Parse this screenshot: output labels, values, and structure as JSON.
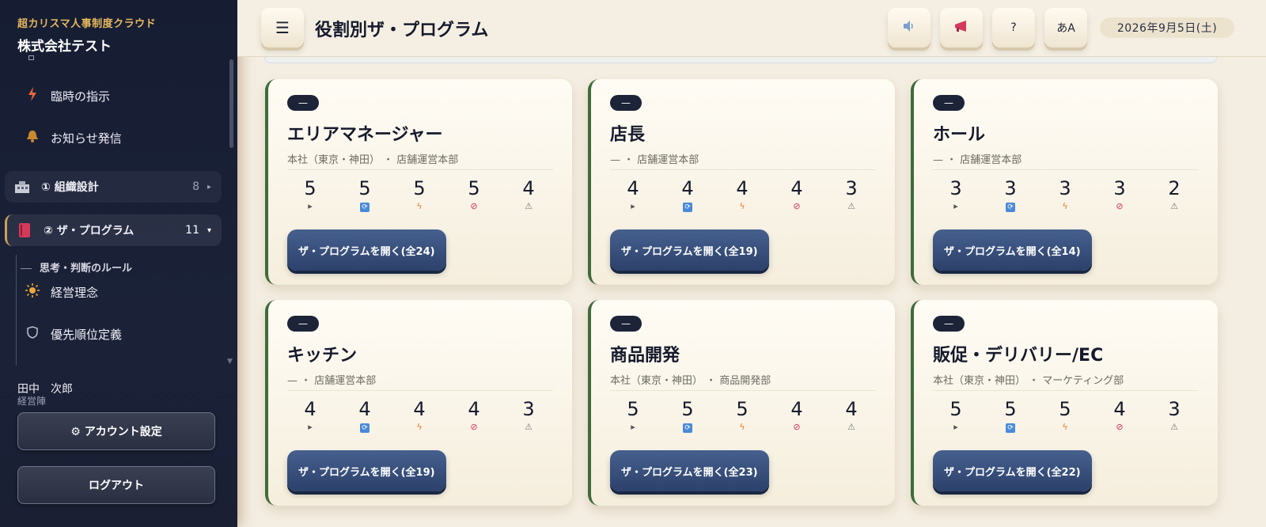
{
  "sidebar": {
    "kicker": "超カリスマ人事制度クラウド",
    "company": "株式会社テスト",
    "items": [
      {
        "icon": "bolt-icon",
        "label": "臨時の指示"
      },
      {
        "icon": "bell-icon",
        "label": "お知らせ発信"
      }
    ],
    "groups": [
      {
        "label": "① 組織設計",
        "count": "8",
        "arrow": "▸"
      },
      {
        "label": "② ザ・プログラム",
        "count": "11",
        "arrow": "▾"
      }
    ],
    "subhead": "思考・判断のルール",
    "subitems": [
      {
        "icon": "sun-icon",
        "label": "経営理念"
      },
      {
        "icon": "shield-icon",
        "label": "優先順位定義"
      }
    ],
    "user": {
      "name": "田中　次郎",
      "role": "経営陣"
    },
    "account_label": "⚙ アカウント設定",
    "logout_label": "ログアウト"
  },
  "header": {
    "menu_glyph": "☰",
    "title": "役割別ザ・プログラム",
    "buttons": [
      {
        "icon": "speaker-icon",
        "glyph": "🔈"
      },
      {
        "icon": "megaphone-icon",
        "glyph": "📢"
      },
      {
        "icon": "help-icon",
        "glyph": "?"
      },
      {
        "icon": "font-size-icon",
        "glyph": "あA"
      }
    ],
    "date": "2026年9月5日(土)"
  },
  "cards": [
    {
      "badge": "—",
      "name": "エリアマネージャー",
      "meta": "本社（東京・神田） ・ 店舗運営本部",
      "stats": [
        "5",
        "5",
        "5",
        "5",
        "4"
      ],
      "button": "ザ・プログラムを開く(全24)"
    },
    {
      "badge": "—",
      "name": "店長",
      "meta": "— ・ 店舗運営本部",
      "stats": [
        "4",
        "4",
        "4",
        "4",
        "3"
      ],
      "button": "ザ・プログラムを開く(全19)"
    },
    {
      "badge": "—",
      "name": "ホール",
      "meta": "— ・ 店舗運営本部",
      "stats": [
        "3",
        "3",
        "3",
        "3",
        "2"
      ],
      "button": "ザ・プログラムを開く(全14)"
    },
    {
      "badge": "—",
      "name": "キッチン",
      "meta": "— ・ 店舗運営本部",
      "stats": [
        "4",
        "4",
        "4",
        "4",
        "3"
      ],
      "button": "ザ・プログラムを開く(全19)"
    },
    {
      "badge": "—",
      "name": "商品開発",
      "meta": "本社（東京・神田） ・ 商品開発部",
      "stats": [
        "5",
        "5",
        "5",
        "4",
        "4"
      ],
      "button": "ザ・プログラムを開く(全23)"
    },
    {
      "badge": "—",
      "name": "販促・デリバリー/EC",
      "meta": "本社（東京・神田） ・ マーケティング部",
      "stats": [
        "5",
        "5",
        "5",
        "4",
        "3"
      ],
      "button": "ザ・プログラムを開く(全22)"
    }
  ],
  "stat_icons": [
    {
      "icon": "play-icon",
      "glyph": "▸"
    },
    {
      "icon": "repeat-icon",
      "glyph": "⟳"
    },
    {
      "icon": "bolt-icon",
      "glyph": "ϟ"
    },
    {
      "icon": "ban-icon",
      "glyph": "⊘"
    },
    {
      "icon": "warning-icon",
      "glyph": "⚠"
    }
  ]
}
